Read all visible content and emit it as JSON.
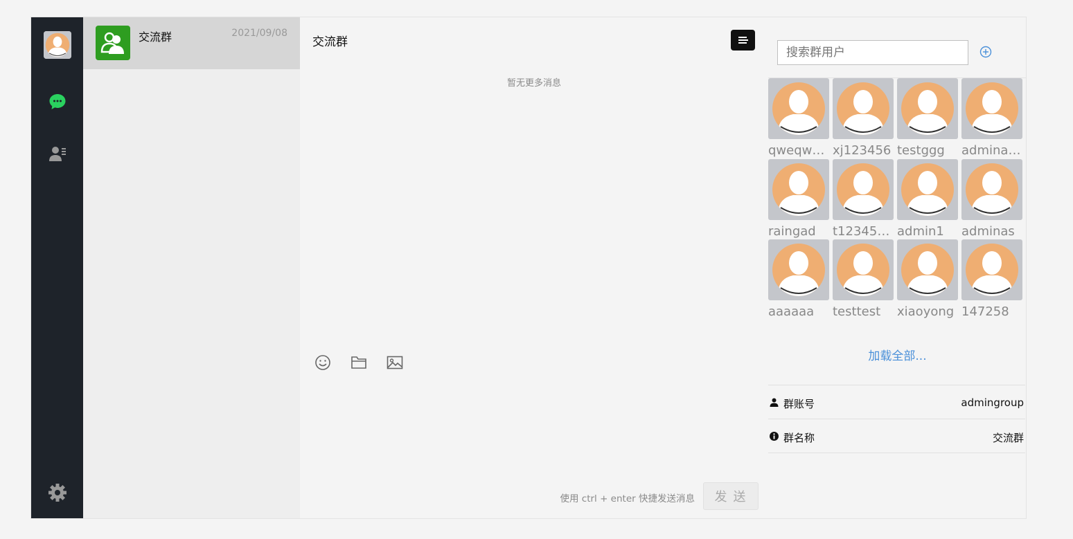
{
  "nav": {
    "avatar_alt": "me",
    "items": [
      {
        "icon": "chat-bubble-icon",
        "color": "#2ad15f"
      },
      {
        "icon": "contacts-icon",
        "color": "#999999"
      }
    ],
    "settings_icon": "gear-icon"
  },
  "conversations": [
    {
      "name": "交流群",
      "date": "2021/09/08",
      "icon": "group-icon",
      "color": "#2e9d20"
    }
  ],
  "chat": {
    "title": "交流群",
    "no_more": "暂无更多消息",
    "tools": [
      "emoji-icon",
      "folder-icon",
      "image-icon"
    ],
    "hint": "使用 ctrl + enter 快捷发送消息",
    "send_label": "发 送"
  },
  "side": {
    "search_placeholder": "搜索群用户",
    "members": [
      "qweqwe...",
      "xj123456",
      "testggg",
      "adminad...",
      "raingad",
      "t123456...",
      "admin1",
      "adminas",
      "aaaaaa",
      "testtest",
      "xiaoyong",
      "147258"
    ],
    "load_all": "加载全部...",
    "info": {
      "account_label": "群账号",
      "account_value": "admingroup",
      "name_label": "群名称",
      "name_value": "交流群"
    }
  },
  "colors": {
    "nav_bg": "#1e232a",
    "avatar_bg": "#c4c6cb",
    "avatar_face": "#efae72",
    "link": "#4a90d9"
  }
}
